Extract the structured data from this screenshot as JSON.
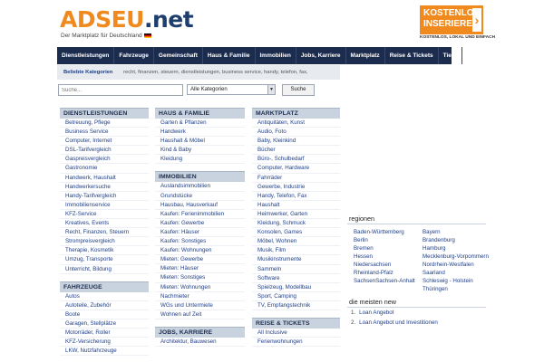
{
  "header": {
    "logo_part1": "ADSEU",
    "logo_part2": ".net",
    "tagline": "Der Marktplatz für Deutschland",
    "promo_line1": "KOSTENLOS",
    "promo_line2": "INSERIEREN",
    "promo_sub": "KOSTENLOS, LOKAL UND EINFACH"
  },
  "nav": [
    "Dienstleistungen",
    "Fahrzeuge",
    "Gemeinschaft",
    "Haus & Familie",
    "Immobilien",
    "Jobs, Karriere",
    "Marktplatz",
    "Reise & Tickets",
    "Tiere"
  ],
  "popular": {
    "label": "Beliebte Kategorien",
    "tags": "recht, finanzen, steuern,   dienstleistungen,   business service,   handy, telefon, fax,"
  },
  "search": {
    "placeholder": "Suche...",
    "category": "Alle Kategorien",
    "button": "Suche"
  },
  "columns": {
    "left": [
      {
        "title": "DIENSTLEISTUNGEN",
        "items": [
          "Betreuung, Pflege",
          "Business Service",
          "Computer, Internet",
          "DSL-Tarifvergleich",
          "Gaspreisvergleich",
          "Gastronomie",
          "Handwerk, Haushalt",
          "Handwerkersuche",
          "Handy-Tarifvergleich",
          "Immobilienservice",
          "KFZ-Service",
          "Kreatives, Events",
          "Recht, Finanzen, Steuern",
          "Strompreisvergleich",
          "Therapie, Kosmetik",
          "Umzug, Transporte",
          "Unterricht, Bildung"
        ]
      },
      {
        "title": "FAHRZEUGE",
        "items": [
          "Autos",
          "Autoteile, Zubehör",
          "Boote",
          "Garagen, Stellplätze",
          "Motorräder, Roller",
          "KFZ-Versicherung",
          "LKW, Nutzfahrzeuge"
        ]
      }
    ],
    "middle": [
      {
        "title": "HAUS & FAMILIE",
        "items": [
          "Garten & Pflanzen",
          "Handwerk",
          "Haushalt & Möbel",
          "Kind & Baby",
          "Kleidung"
        ]
      },
      {
        "title": "IMMOBILIEN",
        "items": [
          "Auslandsimmobilien",
          "Grundstücke",
          "Hausbau, Hausverkauf",
          "Kaufen: Ferienimmobilien",
          "Kaufen: Gewerbe",
          "Kaufen: Häuser",
          "Kaufen: Sonstiges",
          "Kaufen: Wohnungen",
          "Mieten: Gewerbe",
          "Mieten: Häuser",
          "Mieten: Sonstiges",
          "Mieten: Wohnungen",
          "Nachmieter",
          "WGs und Untermiete",
          "Wohnen auf Zeit"
        ]
      },
      {
        "title": "JOBS, KARRIERE",
        "items": [
          "Architektur, Bauwesen"
        ]
      }
    ],
    "right": [
      {
        "title": "MARKTPLATZ",
        "items": [
          "Antiquitäten, Kunst",
          "Audio, Foto",
          "Baby, Kleinkind",
          "Bücher",
          "Büro-, Schulbedarf",
          "Computer, Hardware",
          "Fahrräder",
          "Gewerbe, Industrie",
          "Handy, Telefon, Fax",
          "Haushalt",
          "Heimwerker, Garten",
          "Kleidung, Schmuck",
          "Konsolen, Games",
          "Möbel, Wohnen",
          "Musik, Film",
          "Musikinstrumente",
          "Sammeln",
          "Software",
          "Spielzeug, Modellbau",
          "Sport, Camping",
          "TV, Empfangstechnik"
        ]
      },
      {
        "title": "REISE & TICKETS",
        "items": [
          "All Inclusive",
          "Ferienwohnungen"
        ]
      }
    ]
  },
  "regions": {
    "title": "regionen",
    "items": [
      "Baden-Württemberg",
      "Bayern",
      "Berlin",
      "Brandenburg",
      "Bremen",
      "Hamburg",
      "Hessen",
      "Mecklenburg-Vorpommern",
      "Niedersachsen",
      "Nordrhein-Westfalen",
      "Rheinland-Pfalz",
      "Saarland",
      "SachsenSachsen-Anhalt",
      "Schleswig - Holstein",
      "",
      "Thüringen"
    ]
  },
  "newest": {
    "title": "die meisten new",
    "items": [
      {
        "num": "1.",
        "label": "Loan Angebot"
      },
      {
        "num": "2.",
        "label": "Loan Angebot und Investitionen"
      }
    ]
  },
  "colors": {
    "accent": "#f08a1e",
    "nav": "#1c2c4e",
    "cat_header": "#c9d3df",
    "link": "#1f3f87"
  }
}
